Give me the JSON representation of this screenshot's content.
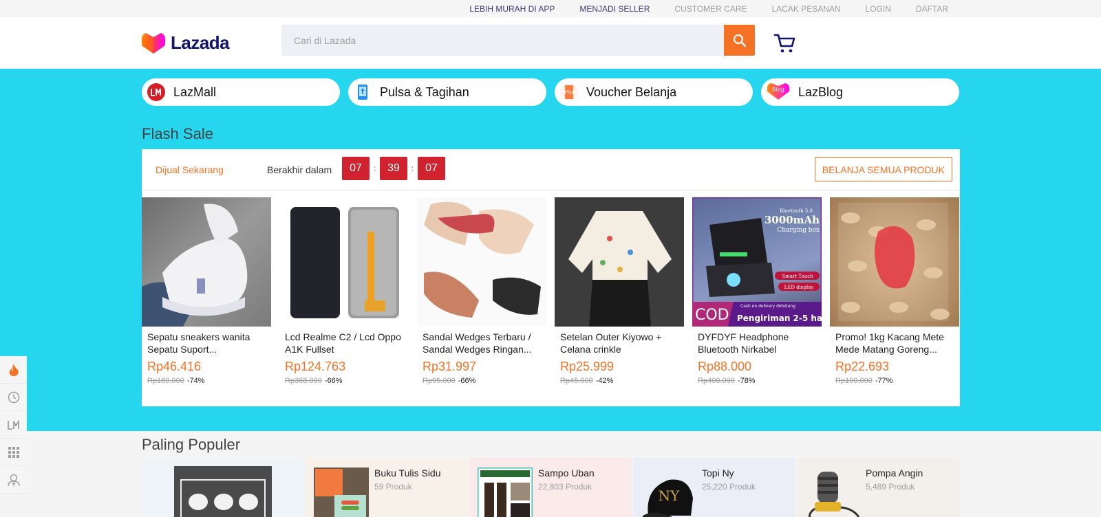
{
  "topbar": {
    "links": [
      "LEBIH MURAH DI APP",
      "MENJADI SELLER",
      "CUSTOMER CARE",
      "LACAK PESANAN",
      "LOGIN",
      "DAFTAR"
    ]
  },
  "header": {
    "brand": "Lazada",
    "search_placeholder": "Cari di Lazada",
    "search_icon": "search-icon",
    "cart_icon": "cart-icon"
  },
  "colors": {
    "accent": "#f57224",
    "band": "#26d6ee",
    "countdown": "#d0232f",
    "brand_navy": "#0f146d"
  },
  "chips": [
    {
      "label": "LazMall",
      "icon": "lazmall-icon"
    },
    {
      "label": "Pulsa & Tagihan",
      "icon": "phone-topup-icon"
    },
    {
      "label": "Voucher Belanja",
      "icon": "voucher-icon"
    },
    {
      "label": "LazBlog",
      "icon": "blog-icon"
    }
  ],
  "flash_sale": {
    "title": "Flash Sale",
    "status": "Dijual Sekarang",
    "ends_label": "Berakhir dalam",
    "countdown": {
      "hours": "07",
      "minutes": "39",
      "seconds": "07"
    },
    "shop_all": "BELANJA SEMUA PRODUK",
    "products": [
      {
        "name": "Sepatu sneakers wanita Sepatu Suport...",
        "price": "Rp46.416",
        "original": "Rp180.000",
        "discount": "-74%"
      },
      {
        "name": "Lcd Realme C2 / Lcd Oppo A1K Fullset",
        "price": "Rp124.763",
        "original": "Rp368.000",
        "discount": "-66%"
      },
      {
        "name": "Sandal Wedges Terbaru / Sandal Wedges Ringan...",
        "price": "Rp31.997",
        "original": "Rp95.000",
        "discount": "-66%"
      },
      {
        "name": "Setelan Outer Kiyowo + Celana crinkle",
        "price": "Rp25.999",
        "original": "Rp45.000",
        "discount": "-42%"
      },
      {
        "name": "DYFDYF Headphone Bluetooth Nirkabel Sentuh...",
        "price": "Rp88.000",
        "original": "Rp400.000",
        "discount": "-78%"
      },
      {
        "name": "Promo! 1kg Kacang Mete Mede Matang Goreng...",
        "price": "Rp22.693",
        "original": "Rp100.000",
        "discount": "-77%"
      }
    ]
  },
  "popular": {
    "title": "Paling Populer",
    "items": [
      {
        "name": "",
        "count": ""
      },
      {
        "name": "Buku Tulis Sidu",
        "count": "59 Produk"
      },
      {
        "name": "Sampo Uban",
        "count": "22,803 Produk"
      },
      {
        "name": "Topi Ny",
        "count": "25,220 Produk"
      },
      {
        "name": "Pompa Angin",
        "count": "5,489 Produk"
      }
    ]
  },
  "sidetool": [
    "flash-sale-icon",
    "history-icon",
    "lazmall-icon",
    "categories-icon",
    "account-icon"
  ]
}
